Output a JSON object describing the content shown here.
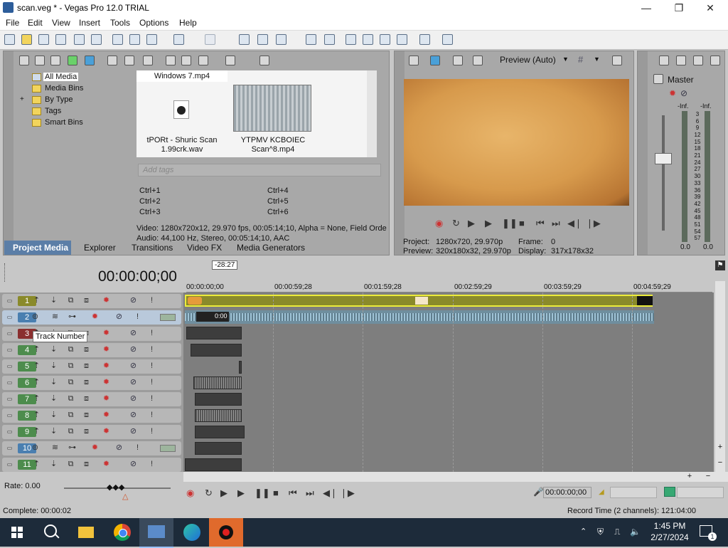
{
  "window": {
    "title": "scan.veg * - Vegas Pro 12.0 TRIAL",
    "minimize": "—",
    "maximize": "❐",
    "close": "✕"
  },
  "menu": [
    "File",
    "Edit",
    "View",
    "Insert",
    "Tools",
    "Options",
    "Help"
  ],
  "media_tree": [
    "All Media",
    "Media Bins",
    "By Type",
    "Tags",
    "Smart Bins"
  ],
  "media_tree_expand": "+",
  "media_header_file": "Windows 7.mp4",
  "media_items": [
    {
      "name": "tPORt - Shuric Scan 1.99crk.wav"
    },
    {
      "name": "YTPMV KCBOIEC Scan^8.mp4"
    }
  ],
  "tags_placeholder": "Add tags",
  "shortcuts": [
    "Ctrl+1",
    "Ctrl+4",
    "Ctrl+2",
    "Ctrl+5",
    "Ctrl+3",
    "Ctrl+6"
  ],
  "media_info_video": "Video: 1280x720x12, 29.970 fps, 00:05:14;10, Alpha = None, Field Orde",
  "media_info_audio": "Audio: 44,100 Hz, Stereo, 00:05:14;10, AAC",
  "tabs": [
    "Project Media",
    "Explorer",
    "Transitions",
    "Video FX",
    "Media Generators"
  ],
  "preview": {
    "mode_label": "Preview (Auto)",
    "project_label": "Project:",
    "project_value": "1280x720, 29.970p",
    "preview_label": "Preview:",
    "preview_value": "320x180x32, 29.970p",
    "frame_label": "Frame:",
    "frame_value": "0",
    "display_label": "Display:",
    "display_value": "317x178x32"
  },
  "mixer": {
    "title": "Master",
    "inf_left": "-Inf.",
    "inf_right": "-Inf.",
    "scale": [
      "3",
      "6",
      "9",
      "12",
      "15",
      "18",
      "21",
      "24",
      "27",
      "30",
      "33",
      "36",
      "39",
      "42",
      "45",
      "48",
      "51",
      "54",
      "57"
    ],
    "value_left": "0.0",
    "value_right": "0.0"
  },
  "timeline": {
    "timecode": "00:00:00;00",
    "cursor_marker": "-28:27",
    "ruler": [
      "00:00:00;00",
      "00:00:59;28",
      "00:01:59;28",
      "00:02:59;29",
      "00:03:59;29",
      "00:04:59;29"
    ],
    "clip_label": "0:00",
    "tracks": [
      {
        "num": "1",
        "kind": "video"
      },
      {
        "num": "2",
        "kind": "audio"
      },
      {
        "num": "3",
        "kind": "video"
      },
      {
        "num": "4",
        "kind": "video"
      },
      {
        "num": "5",
        "kind": "video"
      },
      {
        "num": "6",
        "kind": "video"
      },
      {
        "num": "7",
        "kind": "video"
      },
      {
        "num": "8",
        "kind": "video"
      },
      {
        "num": "9",
        "kind": "video"
      },
      {
        "num": "10",
        "kind": "audio"
      },
      {
        "num": "11",
        "kind": "video"
      }
    ],
    "tooltip": "Track Number",
    "rate": "Rate: 0.00",
    "bottom_timecode": "00:00:00;00"
  },
  "status": {
    "left": "Complete: 00:00:02",
    "right": "Record Time (2 channels): 121:04:00"
  },
  "taskbar": {
    "time": "1:45 PM",
    "date": "2/27/2024",
    "notif_count": "1"
  },
  "colors": {
    "video_track": "#4d8c4d",
    "audio_track": "#4a7fb0",
    "active_tab": "#5b7ea7",
    "timeline_bg": "#7e7e7e",
    "track1_bar": "#8a8a2a",
    "audio_wave": "#9fc3d6"
  }
}
